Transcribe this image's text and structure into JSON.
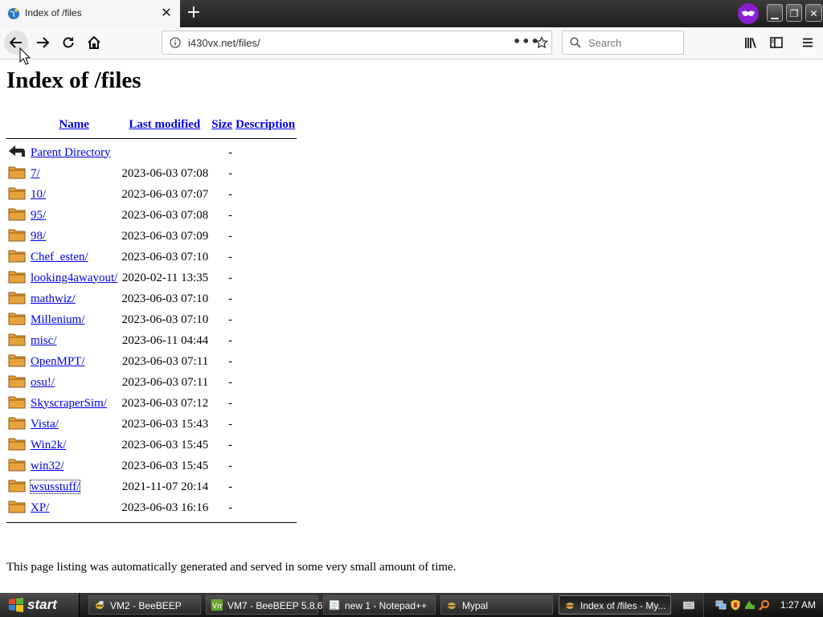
{
  "browser": {
    "tab_title": "Index of /files",
    "url": "i430vx.net/files/",
    "search_placeholder": "Search",
    "new_tab_label": "+"
  },
  "page": {
    "title": "Index of /files",
    "headers": {
      "name": "Name",
      "last_modified": "Last modified",
      "size": "Size",
      "description": "Description"
    },
    "parent": {
      "name": "Parent Directory",
      "size": "-"
    },
    "rows": [
      {
        "name": "7/",
        "modified": "2023-06-03 07:08",
        "size": "-"
      },
      {
        "name": "10/",
        "modified": "2023-06-03 07:07",
        "size": "-"
      },
      {
        "name": "95/",
        "modified": "2023-06-03 07:08",
        "size": "-"
      },
      {
        "name": "98/",
        "modified": "2023-06-03 07:09",
        "size": "-"
      },
      {
        "name": "Chef_esten/",
        "modified": "2023-06-03 07:10",
        "size": "-"
      },
      {
        "name": "looking4awayout/",
        "modified": "2020-02-11 13:35",
        "size": "-"
      },
      {
        "name": "mathwiz/",
        "modified": "2023-06-03 07:10",
        "size": "-"
      },
      {
        "name": "Millenium/",
        "modified": "2023-06-03 07:10",
        "size": "-"
      },
      {
        "name": "misc/",
        "modified": "2023-06-11 04:44",
        "size": "-"
      },
      {
        "name": "OpenMPT/",
        "modified": "2023-06-03 07:11",
        "size": "-"
      },
      {
        "name": "osu!/",
        "modified": "2023-06-03 07:11",
        "size": "-"
      },
      {
        "name": "SkyscraperSim/",
        "modified": "2023-06-03 07:12",
        "size": "-"
      },
      {
        "name": "Vista/",
        "modified": "2023-06-03 15:43",
        "size": "-"
      },
      {
        "name": "Win2k/",
        "modified": "2023-06-03 15:45",
        "size": "-"
      },
      {
        "name": "win32/",
        "modified": "2023-06-03 15:45",
        "size": "-"
      },
      {
        "name": "wsusstuff/",
        "modified": "2021-11-07 20:14",
        "size": "-"
      },
      {
        "name": "XP/",
        "modified": "2023-06-03 16:16",
        "size": "-"
      }
    ],
    "footer": "This page listing was automatically generated and served in some very small amount of time."
  },
  "taskbar": {
    "start_label": "start",
    "tasks": [
      {
        "label": "VM2 - BeeBEEP",
        "icon": "beebeep-icon"
      },
      {
        "label": "VM7 - BeeBEEP 5.8.6",
        "icon": "vm-icon"
      },
      {
        "label": "new 1 - Notepad++",
        "icon": "notepad-icon"
      },
      {
        "label": "Mypal",
        "icon": "mypal-icon"
      },
      {
        "label": "Index of /files - My...",
        "icon": "mypal-icon"
      }
    ],
    "clock": "1:27 AM"
  },
  "colors": {
    "link": "#0000ee",
    "folder": "#e8a33d",
    "private_browsing": "#8b1fd1"
  }
}
